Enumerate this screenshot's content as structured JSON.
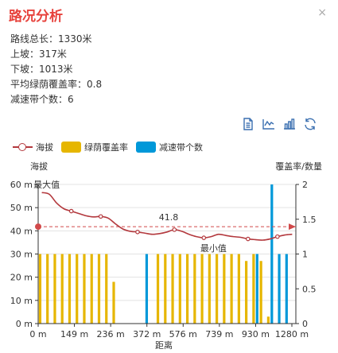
{
  "panel": {
    "title": "路况分析",
    "close_glyph": "×"
  },
  "stats": [
    "路线总长：1330米",
    "上坡：317米",
    "下坡：1013米",
    "平均绿荫覆盖率：0.8",
    "减速带个数：6"
  ],
  "toolbox": [
    "data-view-icon",
    "line-chart-icon",
    "bar-chart-icon",
    "refresh-icon"
  ],
  "colors": {
    "line": "#b3383d",
    "green_cover": "#e6b600",
    "speed_bump": "#0098d9",
    "markline": "#d1494a"
  },
  "chart_data": {
    "type": "bar",
    "legend": [
      "海拔",
      "绿荫覆盖率",
      "减速带个数"
    ],
    "xlabel": "距离",
    "ylabel_left": "海拔",
    "ylabel_right": "覆盖率/数量",
    "y_left_ticks": [
      "0 m",
      "10 m",
      "20 m",
      "30 m",
      "40 m",
      "50 m",
      "60 m"
    ],
    "y_left_range": [
      0,
      60
    ],
    "y_right_ticks": [
      "0",
      "0.5",
      "1",
      "1.5",
      "2"
    ],
    "y_right_range": [
      0,
      2
    ],
    "x_ticks": [
      "0 m",
      "149 m",
      "236 m",
      "372 m",
      "576 m",
      "739 m",
      "930 m",
      "1280 m"
    ],
    "series": [
      {
        "name": "海拔",
        "type": "line",
        "values": [
          56.5,
          55.8,
          52,
          49.5,
          48.5,
          47.5,
          46.5,
          46,
          46.2,
          45.5,
          43,
          40.8,
          39.8,
          39.5,
          39,
          38.5,
          38.8,
          39.5,
          40.5,
          39.8,
          38.5,
          37.5,
          37,
          37.5,
          38.5,
          38,
          37.5,
          37.2,
          36.5,
          36.2,
          36,
          36.5,
          37.5,
          38.2,
          38.5
        ]
      },
      {
        "name": "绿荫覆盖率",
        "type": "bar",
        "values": [
          1,
          1,
          1,
          1,
          1,
          1,
          1,
          1,
          1,
          1,
          0.6,
          0,
          0,
          0,
          0,
          0,
          1,
          1,
          1,
          1,
          1,
          1,
          1,
          1,
          1,
          1,
          1,
          1,
          0.9,
          1,
          0.9,
          0.1,
          0,
          0,
          0
        ]
      },
      {
        "name": "减速带个数",
        "type": "bar",
        "values": [
          0,
          0,
          0,
          0,
          0,
          0,
          0,
          0,
          0,
          0,
          0,
          0,
          0,
          0,
          1,
          0,
          0,
          0,
          0,
          0,
          0,
          0,
          0,
          0,
          0,
          0,
          0,
          0,
          0,
          1,
          0,
          2,
          1,
          1,
          0
        ]
      }
    ],
    "mark_points": {
      "max_label": "最大值",
      "min_label": "最小值"
    },
    "mark_line": {
      "label": "41.8",
      "value": 41.8
    }
  }
}
